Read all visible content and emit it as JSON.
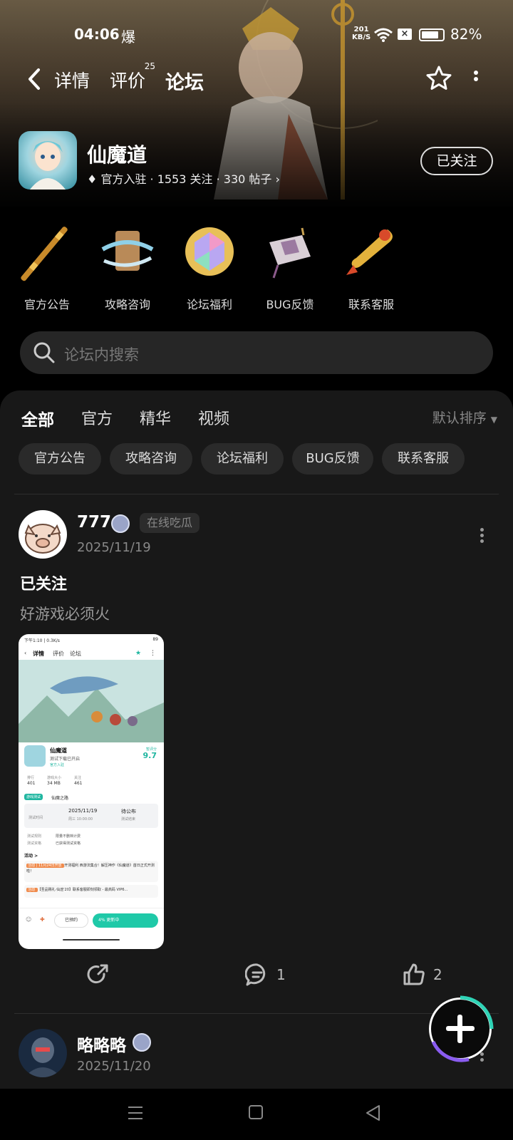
{
  "status": {
    "time": "04:06",
    "notif": "爆",
    "net_speed_top": "201",
    "net_speed_unit": "KB/S",
    "battery_pct": "82%",
    "battery_level": 0.82
  },
  "topnav": {
    "tab_details": "详情",
    "tab_reviews": "评价",
    "reviews_count": "25",
    "tab_forum": "论坛"
  },
  "game": {
    "name": "仙魔道",
    "meta": "官方入驻 · 1553 关注 · 330 帖子",
    "follow_label": "已关注"
  },
  "categories": [
    {
      "label": "官方公告",
      "icon": "staff-icon"
    },
    {
      "label": "攻略咨询",
      "icon": "scroll-icon"
    },
    {
      "label": "论坛福利",
      "icon": "gem-icon"
    },
    {
      "label": "BUG反馈",
      "icon": "lantern-icon"
    },
    {
      "label": "联系客服",
      "icon": "ruyi-icon"
    }
  ],
  "search": {
    "placeholder": "论坛内搜索"
  },
  "tabs": [
    "全部",
    "官方",
    "精华",
    "视频"
  ],
  "sort_label": "默认排序",
  "chips": [
    "官方公告",
    "攻略咨询",
    "论坛福利",
    "BUG反馈",
    "联系客服"
  ],
  "posts": [
    {
      "user": "777",
      "tag": "在线吃瓜",
      "date": "2025/11/19",
      "title": "已关注",
      "body": "好游戏必须火",
      "comments": "1",
      "likes": "2",
      "screenshot": {
        "status": "下午1:10 | 0.3K/s",
        "battery": "89",
        "tabs": [
          "详情",
          "评价",
          "论坛"
        ],
        "game_name": "仙魔道",
        "game_sub": "测试下载已开启",
        "game_tag": "官方入驻",
        "score_label": "暂评分",
        "score": "9.7",
        "stats_labels": [
          "排行",
          "游戏大小",
          "关注"
        ],
        "stats_values": [
          "401",
          "34 MB",
          "461"
        ],
        "test_badge": "游戏测试",
        "test_name": "仙魔之路",
        "test_date": "2025/11/19",
        "test_time": "周三 10:00:00",
        "test_end": "待公布",
        "test_end_label": "测试结束",
        "test_start_label": "测试时间",
        "rules_label1": "测试规则",
        "rules_value1": "限量不删档计费",
        "rules_label2": "测试资格",
        "rules_value2": "已获得测试资格",
        "activity_label": "活动 >",
        "act1_tag": "活动 | 11月24日开放 ",
        "act1_text": "开测福利 西游法集合！解压神作《仙魔道》首日正式开测啦！",
        "act2_tag": "活动 ",
        "act2_text": "【圣品赐礼·仙途'20】联系客服即刻领取 - 最高码 VIP6...",
        "bottom_reserved": "已预约",
        "bottom_btn": "4% 更新中"
      }
    },
    {
      "user": "略略略",
      "date": "2025/11/20"
    }
  ]
}
